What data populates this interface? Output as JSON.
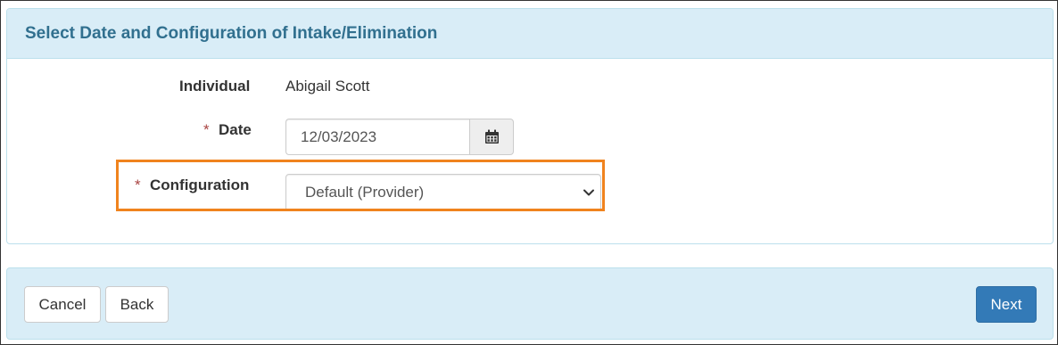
{
  "panel": {
    "title": "Select Date and Configuration of Intake/Elimination"
  },
  "form": {
    "individual": {
      "label": "Individual",
      "value": "Abigail Scott"
    },
    "date": {
      "required_mark": "*",
      "label": "Date",
      "value": "12/03/2023",
      "icon": "calendar-icon"
    },
    "configuration": {
      "required_mark": "*",
      "label": "Configuration",
      "selected": "Default (Provider)",
      "icon": "chevron-down-icon"
    }
  },
  "footer": {
    "cancel_label": "Cancel",
    "back_label": "Back",
    "next_label": "Next"
  },
  "colors": {
    "heading_bg": "#d9edf7",
    "heading_text": "#31708f",
    "required": "#a94442",
    "highlight": "#f0831e",
    "primary": "#337ab7"
  }
}
